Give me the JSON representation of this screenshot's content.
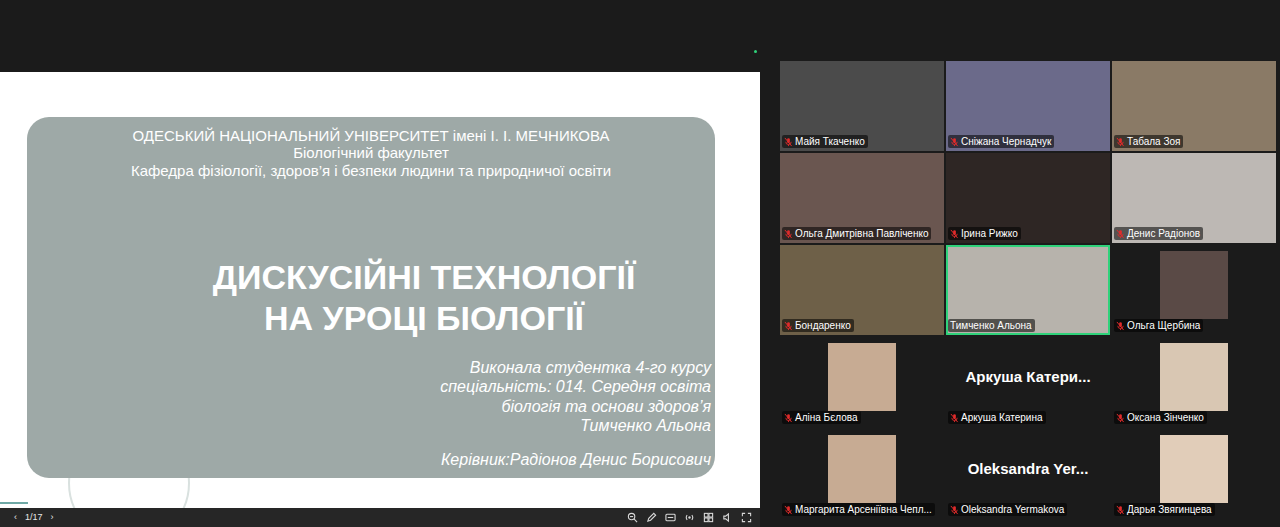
{
  "slide": {
    "university": "ОДЕСЬКИЙ НАЦІОНАЛЬНИЙ УНІВЕРСИТЕТ імені І. І. МЕЧНИКОВА",
    "faculty": "Біологічний факультет",
    "department": "Кафедра фізіології, здоров’я і безпеки людини та природничої освіти",
    "title": [
      "ДИСКУСІЙНІ ТЕХНОЛОГІЇ",
      "НА УРОЦІ БІОЛОГІЇ"
    ],
    "author": [
      "Виконала студентка 4-го курсу",
      "спеціальність: 014. Середня освіта",
      "біологія та основи здоров’я",
      "Тимченко Альона"
    ],
    "supervisor": "Керівник:Радіонов Денис Борисович"
  },
  "slide_toolbar": {
    "prev": "‹",
    "page": "1/17",
    "next": "›"
  },
  "participants": [
    {
      "name": "Майя Ткаченко",
      "kind": "video",
      "muted": true,
      "speaking": false
    },
    {
      "name": "Сніжана Чернадчук",
      "kind": "video",
      "muted": true,
      "speaking": false
    },
    {
      "name": "Табала Зоя",
      "kind": "video",
      "muted": true,
      "speaking": false
    },
    {
      "name": "Ольга Дмитрівна Павліченко",
      "kind": "video",
      "muted": true,
      "speaking": false
    },
    {
      "name": "Ірина Рижко",
      "kind": "video",
      "muted": true,
      "speaking": false
    },
    {
      "name": "Денис Радіонов",
      "kind": "video",
      "muted": true,
      "speaking": false
    },
    {
      "name": "Бондаренко",
      "kind": "video",
      "muted": true,
      "speaking": false
    },
    {
      "name": "Тимченко Альона",
      "kind": "video",
      "muted": false,
      "speaking": true
    },
    {
      "name": "Ольга Щербина",
      "kind": "avatar",
      "muted": true,
      "speaking": false
    },
    {
      "name": "Аліна Бєлова",
      "kind": "avatar",
      "muted": true,
      "speaking": false
    },
    {
      "name": "Аркуша Катерина",
      "kind": "name",
      "display": "Аркуша Катери...",
      "muted": true,
      "speaking": false
    },
    {
      "name": "Оксана Зінченко",
      "kind": "avatar",
      "muted": true,
      "speaking": false
    },
    {
      "name": "Маргарита Арсеніївна Чепл...",
      "kind": "avatar",
      "muted": true,
      "speaking": false
    },
    {
      "name": "Oleksandra Yermakova",
      "kind": "name",
      "display": "Oleksandra Yer...",
      "muted": true,
      "speaking": false
    },
    {
      "name": "Дарья Звягинцева",
      "kind": "avatar",
      "muted": true,
      "speaking": false
    }
  ]
}
